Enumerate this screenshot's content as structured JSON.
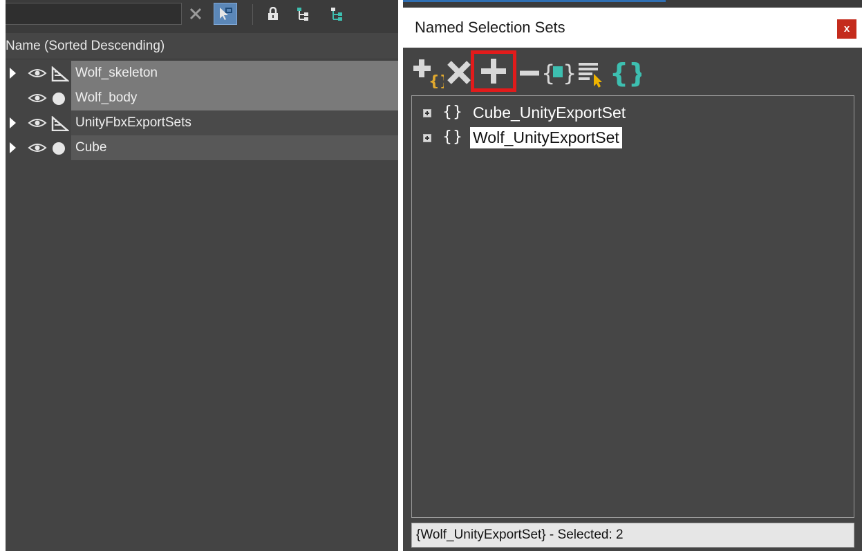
{
  "explorer": {
    "column_header": "Name (Sorted Descending)",
    "toolbar": {
      "icons": [
        "clear-filter-icon",
        "filter-icon",
        "lock-icon",
        "hierarchy-icon",
        "hierarchy-icon"
      ]
    },
    "rows": [
      {
        "label": "Wolf_skeleton",
        "type": "bone",
        "expandable": true,
        "selected": true
      },
      {
        "label": "Wolf_body",
        "type": "geometry",
        "expandable": false,
        "selected": true
      },
      {
        "label": "UnityFbxExportSets",
        "type": "bone",
        "expandable": true,
        "selected": false
      },
      {
        "label": "Cube",
        "type": "geometry",
        "expandable": true,
        "selected": false
      }
    ]
  },
  "named_selection_sets": {
    "title": "Named Selection Sets",
    "close_label": "x",
    "toolbar": [
      "create-new-set-icon",
      "remove-icon",
      "add-selected-objects-icon",
      "subtract-selected-objects-icon",
      "select-objects-in-set-icon",
      "select-objects-by-name-icon",
      "highlight-selected-objects-icon"
    ],
    "highlighted_button": "add-selected-objects",
    "sets": [
      {
        "braces": "{}",
        "label": "Cube_UnityExportSet",
        "selected": false
      },
      {
        "braces": "{}",
        "label": "Wolf_UnityExportSet",
        "selected": true
      }
    ],
    "status": "{Wolf_UnityExportSet} - Selected: 2"
  },
  "colors": {
    "panel_bg": "#444444",
    "selected_row": "#7a7a7a",
    "highlight_border": "#e21b1b",
    "accent_blue": "#5b87b8",
    "brace_yellow": "#e0a82e",
    "brace_teal": "#3dbfb0"
  }
}
